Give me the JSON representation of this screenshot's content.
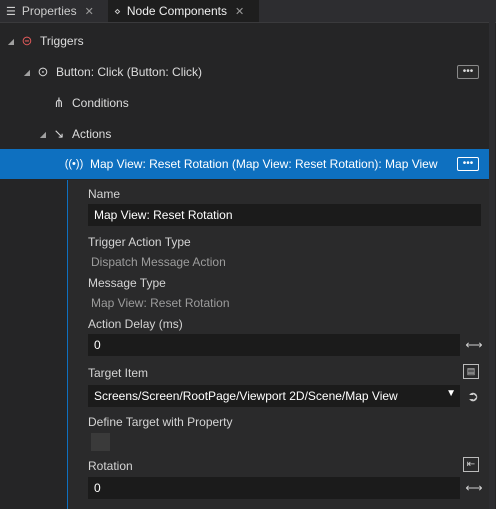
{
  "tabs": [
    {
      "label": "Properties",
      "icon": "list-icon",
      "close": "✕"
    },
    {
      "label": "Node Components",
      "icon": "components-icon",
      "close": "✕"
    }
  ],
  "tree": {
    "triggers": {
      "label": "Triggers",
      "icon": "trigger-icon"
    },
    "button_click": {
      "label": "Button: Click (Button: Click)",
      "icon": "button-click-icon",
      "more": "•••"
    },
    "conditions": {
      "label": "Conditions",
      "icon": "conditions-icon"
    },
    "actions": {
      "label": "Actions",
      "icon": "actions-icon"
    },
    "map_view": {
      "label": "Map View: Reset Rotation (Map View: Reset Rotation): Map View",
      "icon": "broadcast-icon",
      "more": "•••"
    }
  },
  "properties": {
    "name_label": "Name",
    "name_value": "Map View: Reset Rotation",
    "trigger_action_type_label": "Trigger Action Type",
    "trigger_action_type_value": "Dispatch Message Action",
    "message_type_label": "Message Type",
    "message_type_value": "Map View: Reset Rotation",
    "action_delay_label": "Action Delay (ms)",
    "action_delay_value": "0",
    "target_item_label": "Target Item",
    "target_item_value": "Screens/Screen/RootPage/Viewport 2D/Scene/Map View",
    "define_target_label": "Define Target with Property",
    "define_target_checked": false,
    "rotation_label": "Rotation",
    "rotation_value": "0"
  },
  "colors": {
    "selection": "#0e70c0",
    "background": "#252526",
    "panel": "#2a2a2b"
  }
}
